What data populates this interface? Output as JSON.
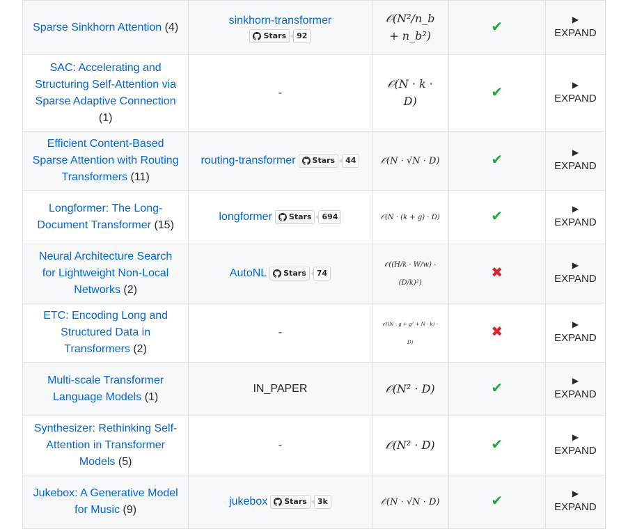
{
  "rows": [
    {
      "title": "Sparse Sinkhorn Attention",
      "count": "(4)",
      "repo": "sinkhorn-transformer",
      "stars_label": "Stars",
      "stars": "92",
      "complexity": "𝒪(N²/n_b + n_b²)",
      "complexity_size": "sz1",
      "decoder": "check",
      "expand": "EXPAND",
      "expand_icon": "▶",
      "repo_layout": "stacked"
    },
    {
      "title": "SAC: Accelerating and Structuring Self-Attention via Sparse Adaptive Connection",
      "count": "(1)",
      "repo": "-",
      "stars_label": "",
      "stars": "",
      "complexity": "𝒪(N · k · D)",
      "complexity_size": "sz1",
      "decoder": "check",
      "expand": "EXPAND",
      "expand_icon": "▶",
      "repo_layout": "text"
    },
    {
      "title": "Efficient Content-Based Sparse Attention with Routing Transformers",
      "count": "(11)",
      "repo": "routing-transformer",
      "stars_label": "Stars",
      "stars": "44",
      "complexity": "𝒪(N · √N · D)",
      "complexity_size": "sz2",
      "decoder": "check",
      "expand": "EXPAND",
      "expand_icon": "▶",
      "repo_layout": "inline"
    },
    {
      "title": "Longformer: The Long-Document Transformer",
      "count": "(15)",
      "repo": "longformer",
      "stars_label": "Stars",
      "stars": "694",
      "complexity": "𝒪(N · (k + g) · D)",
      "complexity_size": "sz3",
      "decoder": "check",
      "expand": "EXPAND",
      "expand_icon": "▶",
      "repo_layout": "inline"
    },
    {
      "title": "Neural Architecture Search for Lightweight Non-Local Networks",
      "count": "(2)",
      "repo": "AutoNL",
      "stars_label": "Stars",
      "stars": "74",
      "complexity": "𝒪((H/k · W/w) · (D/k)²)",
      "complexity_size": "sz3",
      "decoder": "cross",
      "expand": "EXPAND",
      "expand_icon": "▶",
      "repo_layout": "inline"
    },
    {
      "title": "ETC: Encoding Long and Structured Data in Transformers",
      "count": "(2)",
      "repo": "-",
      "stars_label": "",
      "stars": "",
      "complexity": "𝒪((N · g + g² + N · k) · D)",
      "complexity_size": "sz4",
      "decoder": "cross",
      "expand": "EXPAND",
      "expand_icon": "▶",
      "repo_layout": "text"
    },
    {
      "title": "Multi-scale Transformer Language Models",
      "count": "(1)",
      "repo": "IN_PAPER",
      "stars_label": "",
      "stars": "",
      "complexity": "𝒪(N² · D)",
      "complexity_size": "sz1",
      "decoder": "check",
      "expand": "EXPAND",
      "expand_icon": "▶",
      "repo_layout": "text"
    },
    {
      "title": "Synthesizer: Rethinking Self-Attention in Transformer Models",
      "count": "(5)",
      "repo": "-",
      "stars_label": "",
      "stars": "",
      "complexity": "𝒪(N² · D)",
      "complexity_size": "sz1",
      "decoder": "check",
      "expand": "EXPAND",
      "expand_icon": "▶",
      "repo_layout": "text"
    },
    {
      "title": "Jukebox: A Generative Model for Music",
      "count": "(9)",
      "repo": "jukebox",
      "stars_label": "Stars",
      "stars": "3k",
      "complexity": "𝒪(N · √N · D)",
      "complexity_size": "sz2",
      "decoder": "check",
      "expand": "EXPAND",
      "expand_icon": "▶",
      "repo_layout": "inline"
    }
  ],
  "row_heights": [
    78,
    110,
    85,
    77,
    85,
    85,
    77,
    85,
    77
  ],
  "icons": {
    "check": "✔",
    "cross": "✖"
  },
  "colors": {
    "link": "#0366d6",
    "check": "#22a53c",
    "cross": "#d9262c",
    "alt_row": "#f6f8fa",
    "border": "#dfe2e5"
  }
}
